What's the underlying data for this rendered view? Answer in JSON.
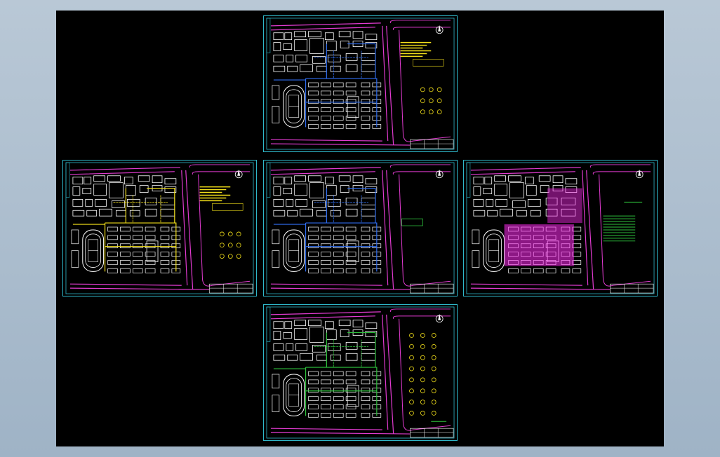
{
  "app": {
    "title": ""
  },
  "colors": {
    "background": "#a9bccd",
    "canvas": "#000000",
    "sheet_border": "#2fb7c9",
    "road": "#e23bd1",
    "building": "#ffffff",
    "water_blue": "#2f6df0",
    "electric_yellow": "#f4e11a",
    "gas_green": "#2ec23c",
    "magenta_fill": "#ff2bf0"
  },
  "sheets": [
    {
      "id": "top",
      "theme": "blue",
      "legend": "yellow"
    },
    {
      "id": "left",
      "theme": "yellow",
      "legend": "yellow"
    },
    {
      "id": "center",
      "theme": "blue",
      "legend": "minimal"
    },
    {
      "id": "right",
      "theme": "magenta",
      "legend": "green"
    },
    {
      "id": "bottom",
      "theme": "green",
      "legend": "yellow-grid"
    }
  ]
}
